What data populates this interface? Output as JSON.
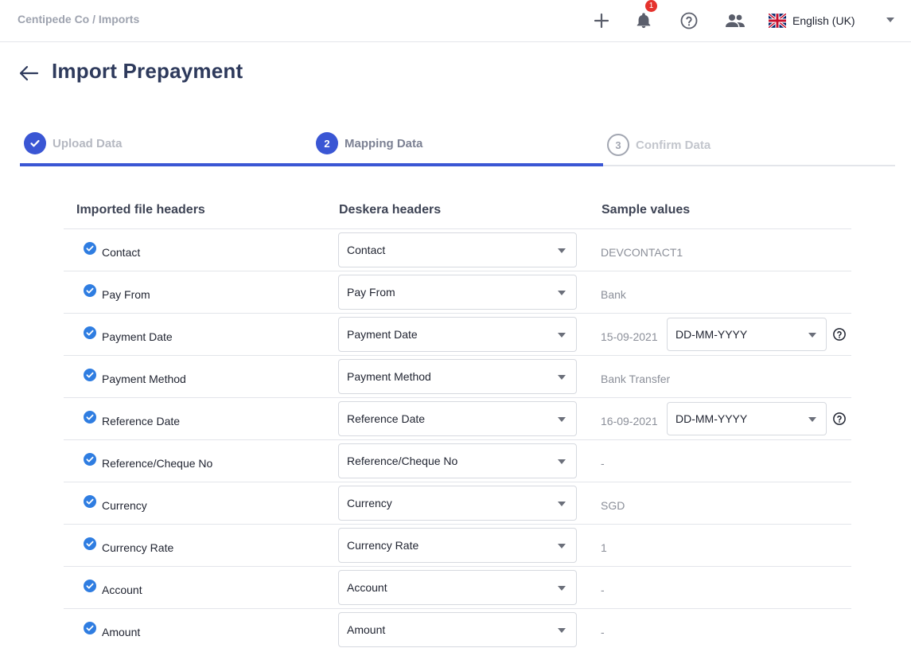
{
  "topbar": {
    "breadcrumb": "Centipede Co / Imports",
    "notification_count": "1",
    "language": "English (UK)",
    "icons": [
      "plus-icon",
      "bell-icon",
      "help-circle-icon",
      "users-icon",
      "uk-flag-icon",
      "chevron-down-icon"
    ]
  },
  "page": {
    "title": "Import Prepayment"
  },
  "stepper": {
    "steps": [
      {
        "number": "",
        "label": "Upload Data",
        "state": "done"
      },
      {
        "number": "2",
        "label": "Mapping Data",
        "state": "active"
      },
      {
        "number": "3",
        "label": "Confirm Data",
        "state": "todo"
      }
    ]
  },
  "table": {
    "headers": {
      "imported": "Imported file headers",
      "deskera": "Deskera headers",
      "sample": "Sample values"
    },
    "rows": [
      {
        "imported": "Contact",
        "deskera": "Contact",
        "sample": "DEVCONTACT1"
      },
      {
        "imported": "Pay From",
        "deskera": "Pay From",
        "sample": "Bank"
      },
      {
        "imported": "Payment Date",
        "deskera": "Payment Date",
        "sample": "15-09-2021",
        "format": "DD-MM-YYYY"
      },
      {
        "imported": "Payment Method",
        "deskera": "Payment Method",
        "sample": "Bank Transfer"
      },
      {
        "imported": "Reference Date",
        "deskera": "Reference Date",
        "sample": "16-09-2021",
        "format": "DD-MM-YYYY"
      },
      {
        "imported": "Reference/Cheque No",
        "deskera": "Reference/Cheque No",
        "sample": "-"
      },
      {
        "imported": "Currency",
        "deskera": "Currency",
        "sample": "SGD"
      },
      {
        "imported": "Currency Rate",
        "deskera": "Currency Rate",
        "sample": "1"
      },
      {
        "imported": "Account",
        "deskera": "Account",
        "sample": "-"
      },
      {
        "imported": "Amount",
        "deskera": "Amount",
        "sample": "-"
      }
    ]
  },
  "colors": {
    "accent": "#3a56d4",
    "check": "#2f7de1",
    "badge": "#e5322d",
    "title": "#2e3a5c"
  }
}
